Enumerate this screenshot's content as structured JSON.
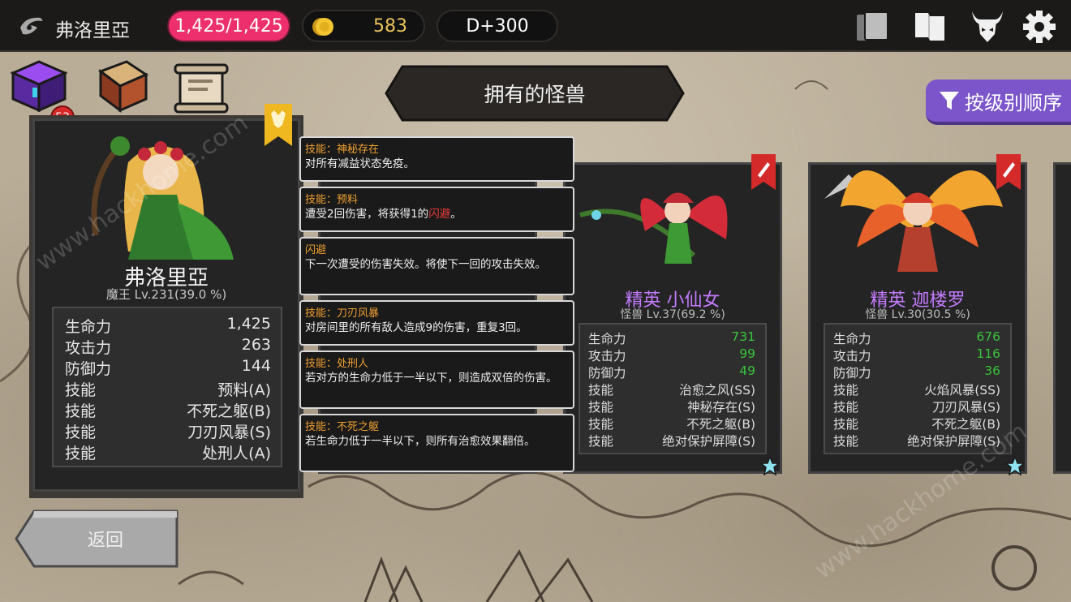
{
  "topbar": {
    "player_name": "弗洛里亞",
    "hp": "1,425/1,425",
    "gold": "583",
    "day": "D+300",
    "icons": [
      "logo-icon",
      "cards-icon",
      "book-icon",
      "demon-icon",
      "gear-icon"
    ],
    "colors": {
      "hp_pill": "#ed2f6d",
      "gold_text": "#e9c35c",
      "bar_bg": "#1c1a18"
    }
  },
  "shelf": {
    "icons": [
      "chest-icon",
      "spellbook-icon",
      "scroll-icon",
      "axe-icon"
    ],
    "badge": "53"
  },
  "title": "拥有的怪兽",
  "sort_button": {
    "label": "按级别顺序",
    "icon": "filter-icon",
    "color": "#7b55c9"
  },
  "main_card": {
    "name": "弗洛里亞",
    "level": "魔王 Lv.231(39.0 %)",
    "stats": [
      {
        "label": "生命力",
        "value": "1,425"
      },
      {
        "label": "攻击力",
        "value": "263"
      },
      {
        "label": "防御力",
        "value": "144"
      },
      {
        "label": "技能",
        "value": "预料(A)"
      },
      {
        "label": "技能",
        "value": "不死之躯(B)"
      },
      {
        "label": "技能",
        "value": "刀刃风暴(S)"
      },
      {
        "label": "技能",
        "value": "处刑人(A)"
      }
    ]
  },
  "tooltips": [
    {
      "title": "技能：神秘存在",
      "body": "对所有减益状态免疫。"
    },
    {
      "title": "技能：预料",
      "body_pre": "遭受2回伤害，将获得1的",
      "body_hl": "闪避",
      "body_post": "。"
    },
    {
      "title": "闪避",
      "body": "下一次遭受的伤害失效。将使下一回的攻击失效。"
    },
    {
      "title": "技能：刀刃风暴",
      "body": "对房间里的所有敌人造成9的伤害，重复3回。"
    },
    {
      "title": "技能：处刑人",
      "body": "若对方的生命力低于一半以下，则造成双倍的伤害。"
    },
    {
      "title": "技能：不死之躯",
      "body": "若生命力低于一半以下，则所有治愈效果翻倍。"
    }
  ],
  "monsters": [
    {
      "name": "精英 小仙女",
      "level": "怪兽 Lv.37(69.2 %)",
      "stats": [
        {
          "label": "生命力",
          "value": "731"
        },
        {
          "label": "攻击力",
          "value": "99"
        },
        {
          "label": "防御力",
          "value": "49"
        },
        {
          "label": "技能",
          "value": "治愈之风(SS)"
        },
        {
          "label": "技能",
          "value": "神秘存在(S)"
        },
        {
          "label": "技能",
          "value": "不死之躯(B)"
        },
        {
          "label": "技能",
          "value": "绝对保护屏障(S)"
        }
      ]
    },
    {
      "name": "精英 迦楼罗",
      "level": "怪兽 Lv.30(30.5 %)",
      "stats": [
        {
          "label": "生命力",
          "value": "676"
        },
        {
          "label": "攻击力",
          "value": "116"
        },
        {
          "label": "防御力",
          "value": "36"
        },
        {
          "label": "技能",
          "value": "火焰风暴(SS)"
        },
        {
          "label": "技能",
          "value": "刀刃风暴(S)"
        },
        {
          "label": "技能",
          "value": "不死之躯(B)"
        },
        {
          "label": "技能",
          "value": "绝对保护屏障(S)"
        }
      ]
    }
  ],
  "back_button": "返回",
  "watermark": "www.hackhome.com"
}
